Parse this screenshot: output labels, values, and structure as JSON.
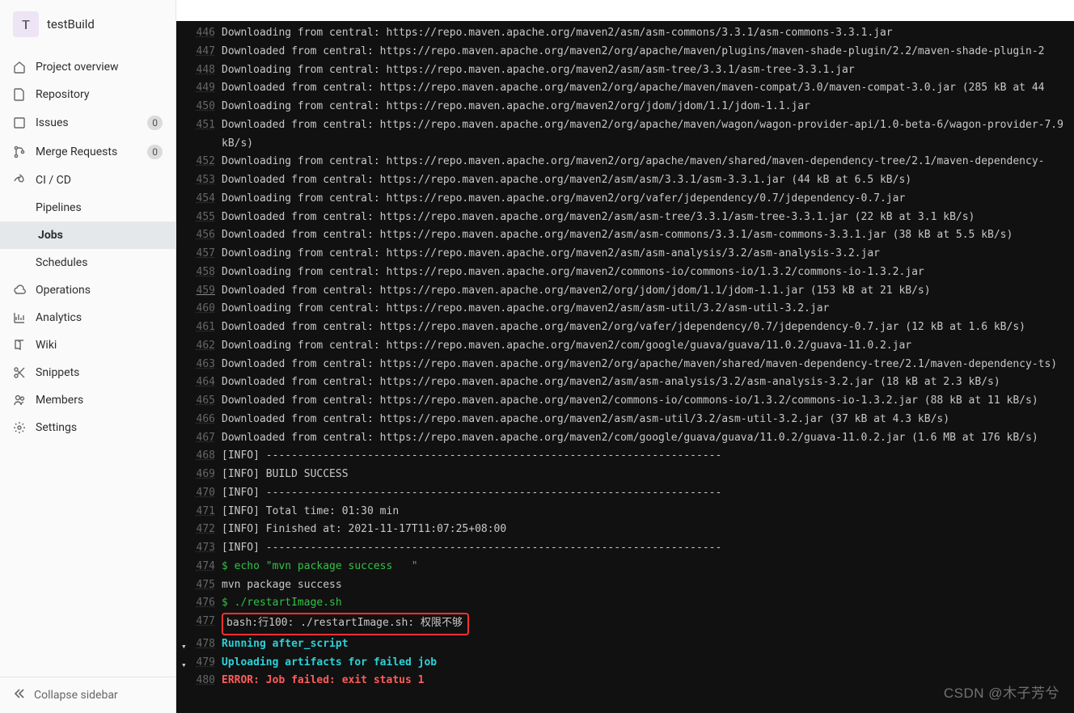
{
  "project": {
    "badge_letter": "T",
    "name": "testBuild"
  },
  "sidebar": {
    "overview": "Project overview",
    "repository": "Repository",
    "issues": {
      "label": "Issues",
      "badge": "0"
    },
    "merge_requests": {
      "label": "Merge Requests",
      "badge": "0"
    },
    "cicd": {
      "label": "CI / CD",
      "pipelines": "Pipelines",
      "jobs": "Jobs",
      "schedules": "Schedules"
    },
    "operations": "Operations",
    "analytics": "Analytics",
    "wiki": "Wiki",
    "snippets": "Snippets",
    "members": "Members",
    "settings": "Settings",
    "collapse": "Collapse sidebar"
  },
  "watermark": "CSDN @木子芳兮",
  "log": {
    "l446": "Downloading from central: https://repo.maven.apache.org/maven2/asm/asm-commons/3.3.1/asm-commons-3.3.1.jar",
    "l447": "Downloaded from central: https://repo.maven.apache.org/maven2/org/apache/maven/plugins/maven-shade-plugin/2.2/maven-shade-plugin-2",
    "l448": "Downloading from central: https://repo.maven.apache.org/maven2/asm/asm-tree/3.3.1/asm-tree-3.3.1.jar",
    "l449": "Downloaded from central: https://repo.maven.apache.org/maven2/org/apache/maven/maven-compat/3.0/maven-compat-3.0.jar (285 kB at 44",
    "l450": "Downloading from central: https://repo.maven.apache.org/maven2/org/jdom/jdom/1.1/jdom-1.1.jar",
    "l451": "Downloaded from central: https://repo.maven.apache.org/maven2/org/apache/maven/wagon/wagon-provider-api/1.0-beta-6/wagon-provider-7.9 kB/s)",
    "l452": "Downloading from central: https://repo.maven.apache.org/maven2/org/apache/maven/shared/maven-dependency-tree/2.1/maven-dependency-",
    "l453": "Downloaded from central: https://repo.maven.apache.org/maven2/asm/asm/3.3.1/asm-3.3.1.jar (44 kB at 6.5 kB/s)",
    "l454": "Downloading from central: https://repo.maven.apache.org/maven2/org/vafer/jdependency/0.7/jdependency-0.7.jar",
    "l455": "Downloaded from central: https://repo.maven.apache.org/maven2/asm/asm-tree/3.3.1/asm-tree-3.3.1.jar (22 kB at 3.1 kB/s)",
    "l456": "Downloaded from central: https://repo.maven.apache.org/maven2/asm/asm-commons/3.3.1/asm-commons-3.3.1.jar (38 kB at 5.5 kB/s)",
    "l457": "Downloading from central: https://repo.maven.apache.org/maven2/asm/asm-analysis/3.2/asm-analysis-3.2.jar",
    "l458": "Downloading from central: https://repo.maven.apache.org/maven2/commons-io/commons-io/1.3.2/commons-io-1.3.2.jar",
    "l459": "Downloaded from central: https://repo.maven.apache.org/maven2/org/jdom/jdom/1.1/jdom-1.1.jar (153 kB at 21 kB/s)",
    "l460": "Downloading from central: https://repo.maven.apache.org/maven2/asm/asm-util/3.2/asm-util-3.2.jar",
    "l461": "Downloaded from central: https://repo.maven.apache.org/maven2/org/vafer/jdependency/0.7/jdependency-0.7.jar (12 kB at 1.6 kB/s)",
    "l462": "Downloading from central: https://repo.maven.apache.org/maven2/com/google/guava/guava/11.0.2/guava-11.0.2.jar",
    "l463": "Downloaded from central: https://repo.maven.apache.org/maven2/org/apache/maven/shared/maven-dependency-tree/2.1/maven-dependency-ts)",
    "l464": "Downloaded from central: https://repo.maven.apache.org/maven2/asm/asm-analysis/3.2/asm-analysis-3.2.jar (18 kB at 2.3 kB/s)",
    "l465": "Downloaded from central: https://repo.maven.apache.org/maven2/commons-io/commons-io/1.3.2/commons-io-1.3.2.jar (88 kB at 11 kB/s)",
    "l466": "Downloaded from central: https://repo.maven.apache.org/maven2/asm/asm-util/3.2/asm-util-3.2.jar (37 kB at 4.3 kB/s)",
    "l467": "Downloaded from central: https://repo.maven.apache.org/maven2/com/google/guava/guava/11.0.2/guava-11.0.2.jar (1.6 MB at 176 kB/s)",
    "l468": "[INFO] ------------------------------------------------------------------------",
    "l469": "[INFO] BUILD SUCCESS",
    "l470": "[INFO] ------------------------------------------------------------------------",
    "l471": "[INFO] Total time: 01:30 min",
    "l472": "[INFO] Finished at: 2021-11-17T11:07:25+08:00",
    "l473": "[INFO] ------------------------------------------------------------------------",
    "l474": "$ echo \"mvn package success   \"",
    "l475": "mvn package success",
    "l476": "$ ./restartImage.sh",
    "l477": "bash:行100: ./restartImage.sh: 权限不够",
    "l478": "Running after_script",
    "l479": "Uploading artifacts for failed job",
    "l480": "ERROR: Job failed: exit status 1"
  },
  "lines": [
    "446",
    "447",
    "448",
    "449",
    "450",
    "451",
    "452",
    "453",
    "454",
    "455",
    "456",
    "457",
    "458",
    "459",
    "460",
    "461",
    "462",
    "463",
    "464",
    "465",
    "466",
    "467",
    "468",
    "469",
    "470",
    "471",
    "472",
    "473",
    "474",
    "475",
    "476",
    "477",
    "478",
    "479",
    "480"
  ]
}
